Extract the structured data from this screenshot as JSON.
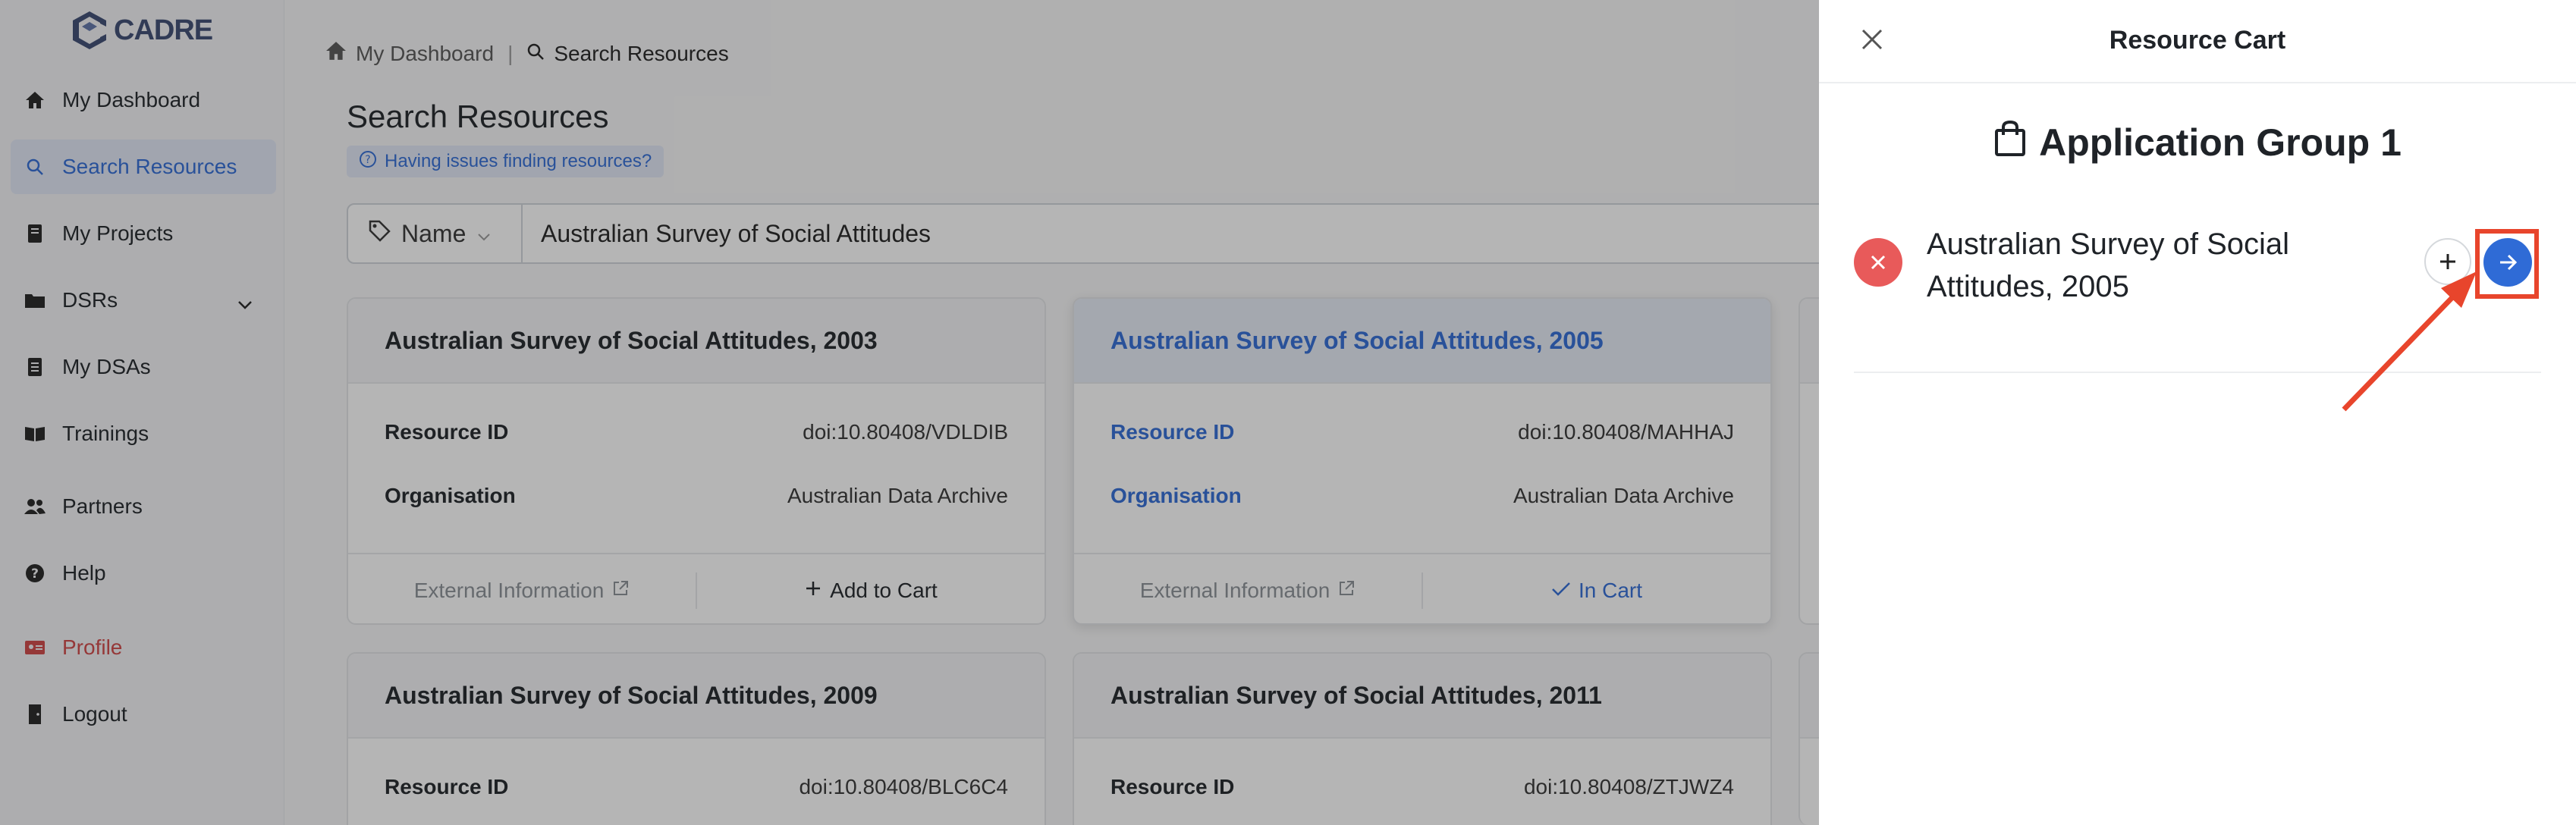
{
  "app": {
    "logo_text": "CADRE"
  },
  "sidebar": {
    "items": [
      {
        "label": "My Dashboard",
        "icon": "home-icon"
      },
      {
        "label": "Search Resources",
        "icon": "search-icon"
      },
      {
        "label": "My Projects",
        "icon": "book-icon"
      },
      {
        "label": "DSRs",
        "icon": "folder-icon"
      },
      {
        "label": "My DSAs",
        "icon": "file-icon"
      },
      {
        "label": "Trainings",
        "icon": "open-book-icon"
      },
      {
        "label": "Partners",
        "icon": "users-icon"
      },
      {
        "label": "Help",
        "icon": "question-icon"
      },
      {
        "label": "Profile",
        "icon": "id-card-icon"
      },
      {
        "label": "Logout",
        "icon": "door-icon"
      }
    ]
  },
  "breadcrumb": {
    "home": "My Dashboard",
    "separator": "|",
    "current": "Search Resources"
  },
  "main": {
    "title": "Search Resources",
    "help_link": "Having issues finding resources?",
    "search": {
      "field": "Name",
      "value": "Australian Survey of Social Attitudes"
    }
  },
  "cards": [
    {
      "title": "Australian Survey of Social Attitudes, 2003",
      "id_label": "Resource ID",
      "id": "doi:10.80408/VDLDIB",
      "org_label": "Organisation",
      "org": "Australian Data Archive",
      "ext": "External Information",
      "action": "Add to Cart"
    },
    {
      "title": "Australian Survey of Social Attitudes, 2005",
      "id_label": "Resource ID",
      "id": "doi:10.80408/MAHHAJ",
      "org_label": "Organisation",
      "org": "Australian Data Archive",
      "ext": "External Information",
      "action": "In Cart"
    },
    {
      "title": "Australian Survey of Social Attitudes, 2009",
      "id_label": "Resource ID",
      "id": "doi:10.80408/BLC6C4"
    },
    {
      "title": "Australian Survey of Social Attitudes, 2011",
      "id_label": "Resource ID",
      "id": "doi:10.80408/ZTJWZ4"
    }
  ],
  "cart": {
    "title": "Resource Cart",
    "group_title": "Application Group 1",
    "items": [
      {
        "name": "Australian Survey of Social Attitudes, 2005"
      }
    ]
  },
  "colors": {
    "accent": "#2f6bd6",
    "danger": "#e85a5a",
    "annotation": "#e8452c"
  }
}
